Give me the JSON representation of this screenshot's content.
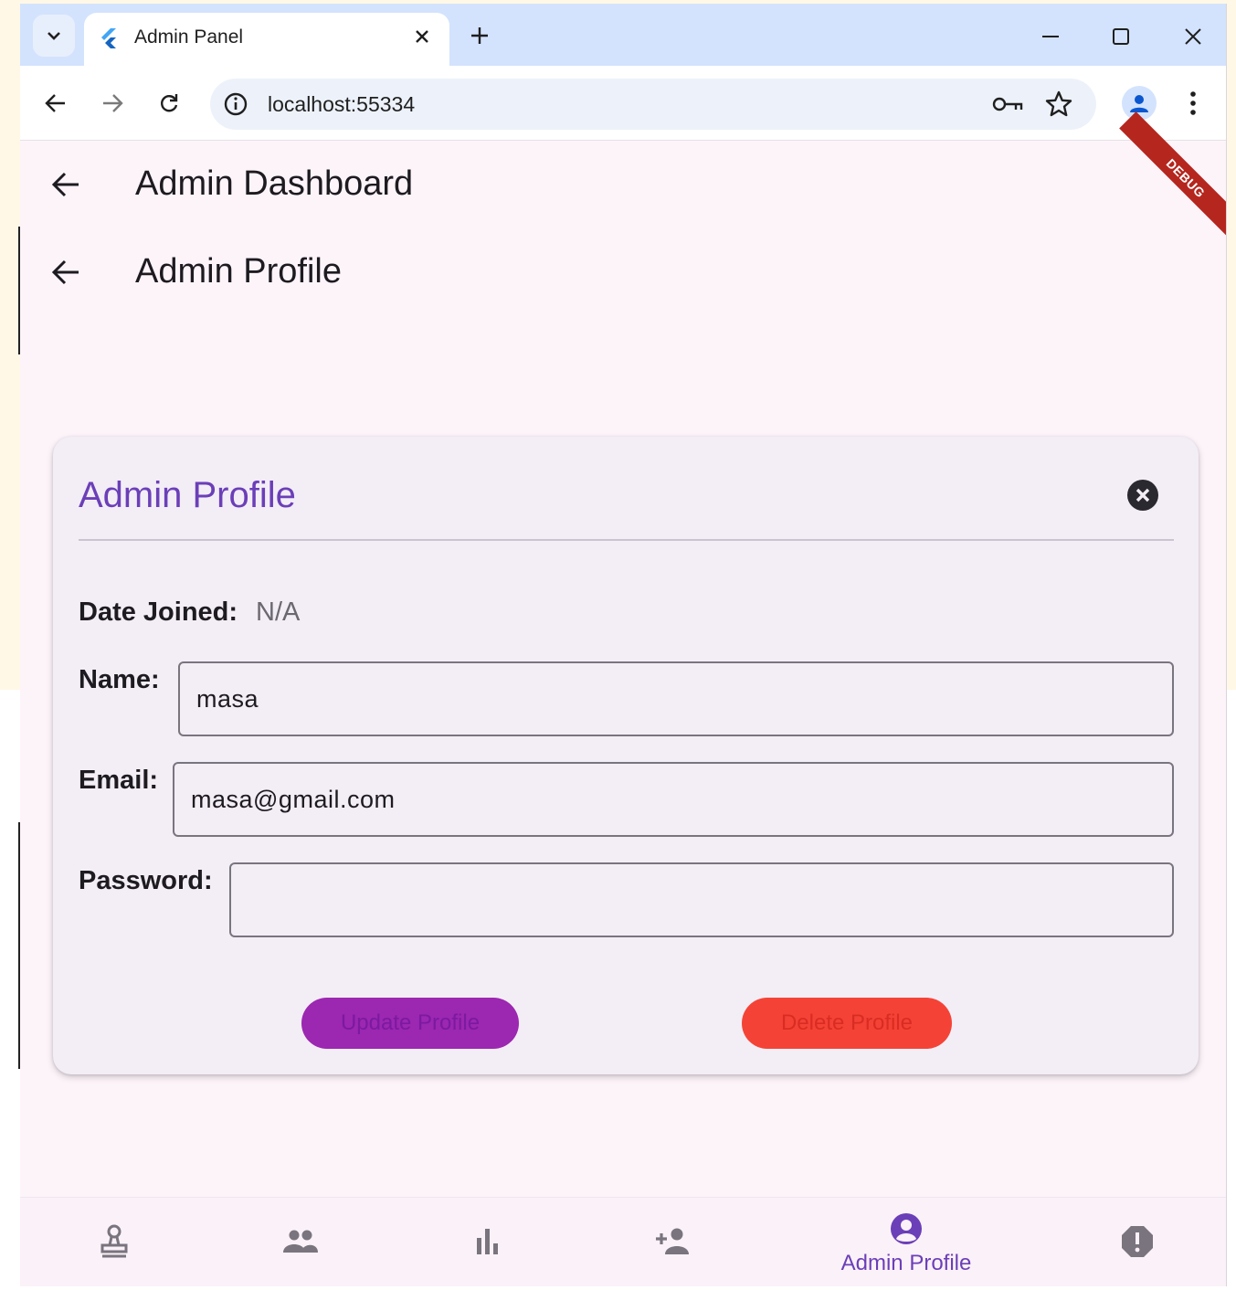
{
  "browser": {
    "tab_title": "Admin Panel",
    "url": "localhost:55334"
  },
  "app": {
    "debug_banner": "DEBUG",
    "appbars": [
      {
        "title": "Admin Dashboard"
      },
      {
        "title": "Admin Profile"
      }
    ]
  },
  "dialog": {
    "title": "Admin Profile",
    "date_joined_label": "Date Joined:",
    "date_joined_value": "N/A",
    "name_label": "Name:",
    "name_value": "masa",
    "email_label": "Email:",
    "email_value": "masa@gmail.com",
    "password_label": "Password:",
    "password_value": "",
    "update_button": "Update Profile",
    "delete_button": "Delete Profile"
  },
  "bottom_nav": {
    "items": [
      {
        "icon": "stamp-icon",
        "label": ""
      },
      {
        "icon": "group-icon",
        "label": ""
      },
      {
        "icon": "bar-chart-icon",
        "label": ""
      },
      {
        "icon": "add-person-icon",
        "label": ""
      },
      {
        "icon": "account-circle-icon",
        "label": "Admin Profile",
        "selected": true
      },
      {
        "icon": "alert-icon",
        "label": ""
      }
    ]
  },
  "colors": {
    "accent": "#6b3fb8",
    "update_button_bg": "#9c27b0",
    "delete_button_bg": "#f44336",
    "debug_banner": "#b5261e"
  }
}
